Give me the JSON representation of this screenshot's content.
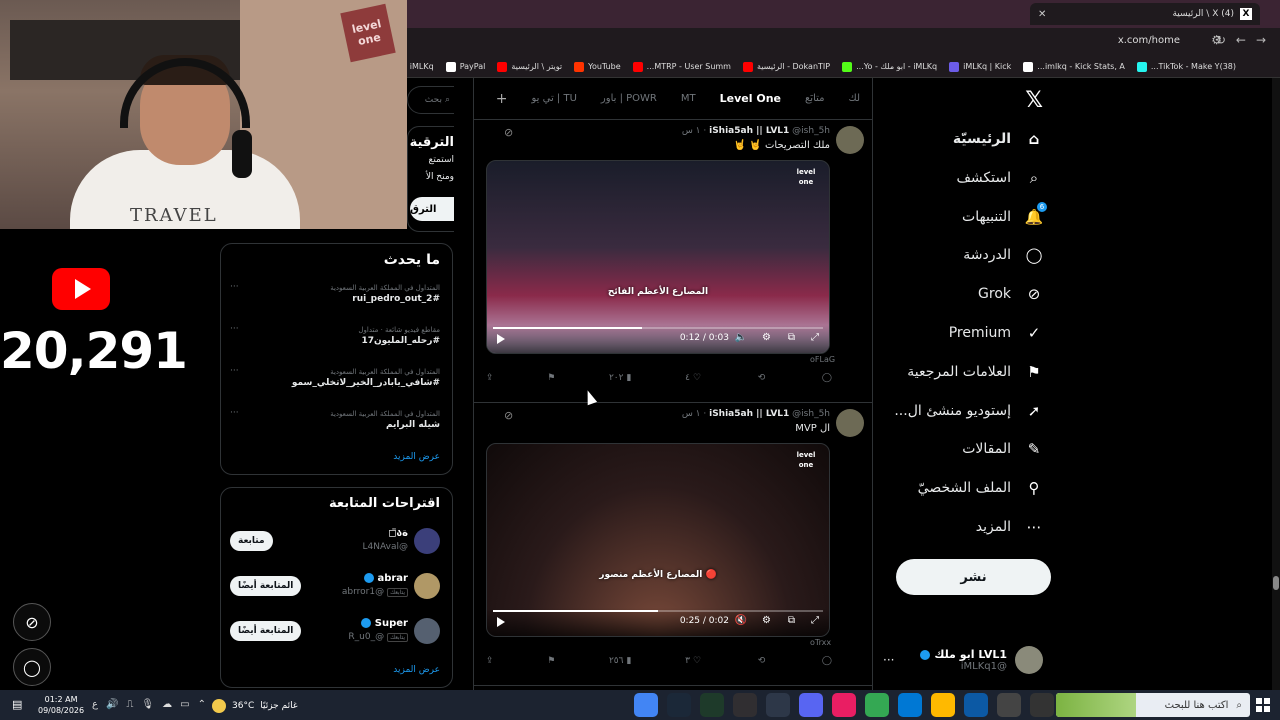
{
  "browser": {
    "tab_title": "(4) X \\ الرئيسية",
    "tab_icon": "X",
    "url": "x.com/home",
    "bookmarks": [
      {
        "label": "(38)TikTok - Make Y...",
        "color": "#25f4ee"
      },
      {
        "label": "imlkq - Kick Stats, A...",
        "color": "#ffffff"
      },
      {
        "label": "iMLKq | Kick",
        "color": "#6c5ce7"
      },
      {
        "label": "iMLKq - ابو ملك - Yo...",
        "color": "#53fc18"
      },
      {
        "label": "DokanTIP - الرئيسية",
        "color": "#ff0000"
      },
      {
        "label": "MTRP - User Summ...",
        "color": "#ff0000"
      },
      {
        "label": "YouTube",
        "color": "#ff3300"
      },
      {
        "label": "تويتر \\ الرئيسية",
        "color": "#ff0000"
      },
      {
        "label": "PayPal",
        "color": "#ffffff"
      },
      {
        "label": "iMLKq",
        "color": "#003087"
      }
    ]
  },
  "stream": {
    "webcam_logo": "level one",
    "shirt_text": "TRAVEL",
    "yt_count": "20,291"
  },
  "nav": {
    "items": [
      {
        "label": "الرئيسيّة",
        "icon": "home-icon",
        "glyph": "⌂",
        "active": true
      },
      {
        "label": "استكشف",
        "icon": "search-icon",
        "glyph": "⌕"
      },
      {
        "label": "التنبيهات",
        "icon": "bell-icon",
        "glyph": "🔔",
        "badge": "6"
      },
      {
        "label": "الدردشة",
        "icon": "chat-icon",
        "glyph": "◯"
      },
      {
        "label": "Grok",
        "icon": "grok-icon",
        "glyph": "⊘"
      },
      {
        "label": "Premium",
        "icon": "premium-icon",
        "glyph": "✓"
      },
      {
        "label": "العلامات المرجعية",
        "icon": "bookmark-icon",
        "glyph": "⚑"
      },
      {
        "label": "إستوديو منشئ ال...",
        "icon": "rocket-icon",
        "glyph": "➚"
      },
      {
        "label": "المقالات",
        "icon": "articles-icon",
        "glyph": "✎"
      },
      {
        "label": "الملف الشخصيّ",
        "icon": "profile-icon",
        "glyph": "⚲"
      },
      {
        "label": "المزيد",
        "icon": "more-icon",
        "glyph": "⋯"
      }
    ],
    "post_button": "نشر",
    "account": {
      "name": "LVL1 ابو ملك",
      "handle": "@iMLKq1",
      "more": "···"
    }
  },
  "timeline": {
    "tabs": [
      {
        "label": "لك"
      },
      {
        "label": "متابَع"
      },
      {
        "label": "Level One",
        "active": true
      },
      {
        "label": "MT"
      },
      {
        "label": "POWR | باور"
      },
      {
        "label": "TU | تي يو"
      }
    ],
    "tweets": [
      {
        "name": "iShia5ah || LVL1",
        "handle": "@ish_5h",
        "time": "١ س",
        "text": "ملك التصريحات 🤘 🤘",
        "overlay": "المصارع الأعظم الفائح",
        "video_time": "0:12 / 0:03",
        "progress": 0.45,
        "source": "oFLaG",
        "replies": "",
        "retweets": "",
        "likes": "٤",
        "views": "٢٠٢"
      },
      {
        "name": "iShia5ah || LVL1",
        "handle": "@ish_5h",
        "time": "١ س",
        "text": "ال MVP",
        "overlay": "المصارع الأعظم منصور 🔴",
        "video_time": "0:25 / 0:02",
        "progress": 0.5,
        "source": "oTrxx",
        "replies": "",
        "retweets": "",
        "likes": "٣",
        "views": "٢٥٦"
      }
    ]
  },
  "sidebar": {
    "search_placeholder": "بحث",
    "premium": {
      "title": "الترقية",
      "desc_1": "استمتع",
      "desc_2": "ومنح الأ",
      "button": "الترق"
    },
    "trends_title": "ما يحدث",
    "trends": [
      {
        "meta": "المتداول في المملكة العربية السعودية",
        "name": "#rui_pedro_out_2"
      },
      {
        "meta": "مقاطع فيديو شائعة · متداول",
        "name": "#رحله_المليون17"
      },
      {
        "meta": "المتداول في المملكة العربية السعودية",
        "name": "#شافي_يابادر_الخير_لاتخلي_سمو"
      },
      {
        "meta": "المتداول في المملكة العربية السعودية",
        "name": "شيله البرايم"
      }
    ],
    "trends_more": "عرض المزيد",
    "follows_title": "اقتراحات المتابعة",
    "follows": [
      {
        "name": "ةა◻̈ ",
        "handle": "@L4NAval",
        "button": "متابعة",
        "tag": ""
      },
      {
        "name": "abrar",
        "handle": "@abrror1",
        "button": "المتابعة أيضًا",
        "tag": "يتابعك"
      },
      {
        "name": "Super",
        "handle": "@_R_u0",
        "button": "المتابعة أيضًا",
        "tag": "يتابعك"
      }
    ],
    "follows_more": "عرض المزيد"
  },
  "taskbar": {
    "time": "01:2 AM",
    "date": "09/08/2026",
    "weather_temp": "36°C",
    "weather_text": "غائم جزئيًا",
    "search_placeholder": "اكتب هنا للبحث",
    "lang": "ع",
    "notif_count": "5",
    "apps": [
      {
        "icon": "chrome-icon",
        "color": "#4285f4"
      },
      {
        "icon": "steam-icon",
        "color": "#1b2838"
      },
      {
        "icon": "app-green-icon",
        "color": "#1e3a2a"
      },
      {
        "icon": "obs-icon",
        "color": "#302e31"
      },
      {
        "icon": "x-app-icon",
        "color": "#2d3748"
      },
      {
        "icon": "discord-icon",
        "color": "#5865f2"
      },
      {
        "icon": "app-colorful-icon",
        "color": "#e91e63"
      },
      {
        "icon": "chrome2-icon",
        "color": "#34a853"
      },
      {
        "icon": "mail-icon",
        "color": "#0078d4"
      },
      {
        "icon": "files-icon",
        "color": "#ffb900"
      },
      {
        "icon": "edge-icon",
        "color": "#0c59a4"
      },
      {
        "icon": "store-icon",
        "color": "#444"
      },
      {
        "icon": "taskview-icon",
        "color": "#333"
      }
    ]
  }
}
